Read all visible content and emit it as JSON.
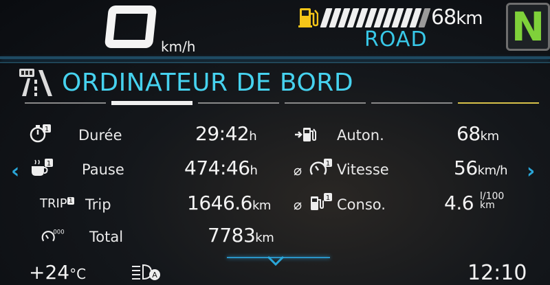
{
  "speed": {
    "value": "0",
    "unit": "km/h"
  },
  "fuel": {
    "bars_total": 12,
    "bars_lit": 11
  },
  "range_top": {
    "value": "68",
    "unit": "km"
  },
  "drive_mode": "ROAD",
  "gear": "N",
  "title": "ORDINATEUR DE BORD",
  "tabs": {
    "count": 6,
    "active_index": 1
  },
  "left_rows": [
    {
      "label": "Durée",
      "value": "29:42",
      "unit": "h",
      "icon": "stopwatch-icon",
      "badge": "1"
    },
    {
      "label": "Pause",
      "value": "474:46",
      "unit": "h",
      "icon": "coffee-cup-icon",
      "badge": "1"
    },
    {
      "label": "Trip",
      "value": "1646.6",
      "unit": "km",
      "icon": "trip-icon",
      "prefix": "TRIP",
      "badge": "1"
    },
    {
      "label": "Total",
      "value": "7783",
      "unit": "km",
      "icon": "odometer-icon",
      "badge": "000"
    }
  ],
  "right_rows": [
    {
      "label": "Auton.",
      "value": "68",
      "unit": "km",
      "icon": "fuel-range-icon"
    },
    {
      "label": "Vitesse",
      "value": "56",
      "unit": "km/h",
      "icon": "average-speed-icon",
      "prefix": "⌀",
      "badge": "1"
    },
    {
      "label": "Conso.",
      "value": "4.6",
      "unit_top": "l/100",
      "unit_bottom": "km",
      "icon": "fuel-consumption-icon",
      "prefix": "⌀",
      "badge": "1"
    }
  ],
  "temperature": {
    "value": "+24",
    "unit": "°C"
  },
  "clock": "12:10",
  "icons": {
    "nav_left": "chevron-left-icon",
    "nav_right": "chevron-right-icon",
    "lights": "headlight-auto-icon"
  },
  "colors": {
    "accent": "#46d2ef",
    "gear": "#7fd13a",
    "fuel_warning": "#f5c518"
  }
}
